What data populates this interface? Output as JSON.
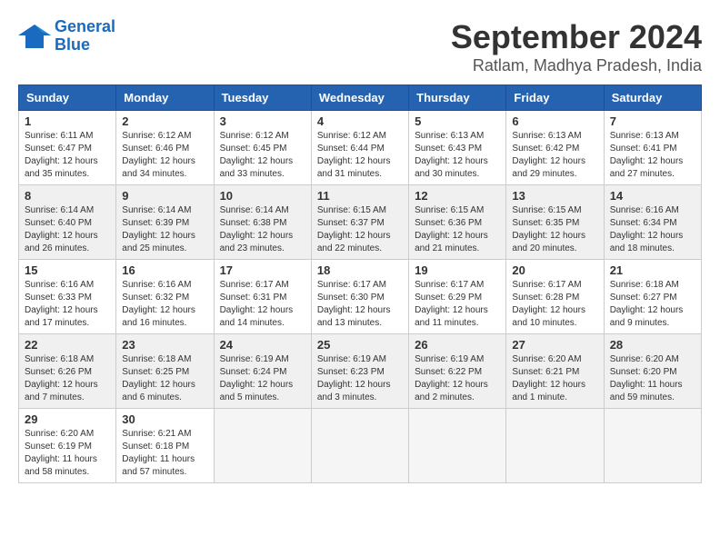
{
  "logo": {
    "line1": "General",
    "line2": "Blue"
  },
  "title": "September 2024",
  "subtitle": "Ratlam, Madhya Pradesh, India",
  "weekdays": [
    "Sunday",
    "Monday",
    "Tuesday",
    "Wednesday",
    "Thursday",
    "Friday",
    "Saturday"
  ],
  "weeks": [
    [
      {
        "day": "1",
        "sunrise": "6:11 AM",
        "sunset": "6:47 PM",
        "daylight": "12 hours and 35 minutes."
      },
      {
        "day": "2",
        "sunrise": "6:12 AM",
        "sunset": "6:46 PM",
        "daylight": "12 hours and 34 minutes."
      },
      {
        "day": "3",
        "sunrise": "6:12 AM",
        "sunset": "6:45 PM",
        "daylight": "12 hours and 33 minutes."
      },
      {
        "day": "4",
        "sunrise": "6:12 AM",
        "sunset": "6:44 PM",
        "daylight": "12 hours and 31 minutes."
      },
      {
        "day": "5",
        "sunrise": "6:13 AM",
        "sunset": "6:43 PM",
        "daylight": "12 hours and 30 minutes."
      },
      {
        "day": "6",
        "sunrise": "6:13 AM",
        "sunset": "6:42 PM",
        "daylight": "12 hours and 29 minutes."
      },
      {
        "day": "7",
        "sunrise": "6:13 AM",
        "sunset": "6:41 PM",
        "daylight": "12 hours and 27 minutes."
      }
    ],
    [
      {
        "day": "8",
        "sunrise": "6:14 AM",
        "sunset": "6:40 PM",
        "daylight": "12 hours and 26 minutes."
      },
      {
        "day": "9",
        "sunrise": "6:14 AM",
        "sunset": "6:39 PM",
        "daylight": "12 hours and 25 minutes."
      },
      {
        "day": "10",
        "sunrise": "6:14 AM",
        "sunset": "6:38 PM",
        "daylight": "12 hours and 23 minutes."
      },
      {
        "day": "11",
        "sunrise": "6:15 AM",
        "sunset": "6:37 PM",
        "daylight": "12 hours and 22 minutes."
      },
      {
        "day": "12",
        "sunrise": "6:15 AM",
        "sunset": "6:36 PM",
        "daylight": "12 hours and 21 minutes."
      },
      {
        "day": "13",
        "sunrise": "6:15 AM",
        "sunset": "6:35 PM",
        "daylight": "12 hours and 20 minutes."
      },
      {
        "day": "14",
        "sunrise": "6:16 AM",
        "sunset": "6:34 PM",
        "daylight": "12 hours and 18 minutes."
      }
    ],
    [
      {
        "day": "15",
        "sunrise": "6:16 AM",
        "sunset": "6:33 PM",
        "daylight": "12 hours and 17 minutes."
      },
      {
        "day": "16",
        "sunrise": "6:16 AM",
        "sunset": "6:32 PM",
        "daylight": "12 hours and 16 minutes."
      },
      {
        "day": "17",
        "sunrise": "6:17 AM",
        "sunset": "6:31 PM",
        "daylight": "12 hours and 14 minutes."
      },
      {
        "day": "18",
        "sunrise": "6:17 AM",
        "sunset": "6:30 PM",
        "daylight": "12 hours and 13 minutes."
      },
      {
        "day": "19",
        "sunrise": "6:17 AM",
        "sunset": "6:29 PM",
        "daylight": "12 hours and 11 minutes."
      },
      {
        "day": "20",
        "sunrise": "6:17 AM",
        "sunset": "6:28 PM",
        "daylight": "12 hours and 10 minutes."
      },
      {
        "day": "21",
        "sunrise": "6:18 AM",
        "sunset": "6:27 PM",
        "daylight": "12 hours and 9 minutes."
      }
    ],
    [
      {
        "day": "22",
        "sunrise": "6:18 AM",
        "sunset": "6:26 PM",
        "daylight": "12 hours and 7 minutes."
      },
      {
        "day": "23",
        "sunrise": "6:18 AM",
        "sunset": "6:25 PM",
        "daylight": "12 hours and 6 minutes."
      },
      {
        "day": "24",
        "sunrise": "6:19 AM",
        "sunset": "6:24 PM",
        "daylight": "12 hours and 5 minutes."
      },
      {
        "day": "25",
        "sunrise": "6:19 AM",
        "sunset": "6:23 PM",
        "daylight": "12 hours and 3 minutes."
      },
      {
        "day": "26",
        "sunrise": "6:19 AM",
        "sunset": "6:22 PM",
        "daylight": "12 hours and 2 minutes."
      },
      {
        "day": "27",
        "sunrise": "6:20 AM",
        "sunset": "6:21 PM",
        "daylight": "12 hours and 1 minute."
      },
      {
        "day": "28",
        "sunrise": "6:20 AM",
        "sunset": "6:20 PM",
        "daylight": "11 hours and 59 minutes."
      }
    ],
    [
      {
        "day": "29",
        "sunrise": "6:20 AM",
        "sunset": "6:19 PM",
        "daylight": "11 hours and 58 minutes."
      },
      {
        "day": "30",
        "sunrise": "6:21 AM",
        "sunset": "6:18 PM",
        "daylight": "11 hours and 57 minutes."
      },
      {
        "day": "",
        "sunrise": "",
        "sunset": "",
        "daylight": ""
      },
      {
        "day": "",
        "sunrise": "",
        "sunset": "",
        "daylight": ""
      },
      {
        "day": "",
        "sunrise": "",
        "sunset": "",
        "daylight": ""
      },
      {
        "day": "",
        "sunrise": "",
        "sunset": "",
        "daylight": ""
      },
      {
        "day": "",
        "sunrise": "",
        "sunset": "",
        "daylight": ""
      }
    ]
  ]
}
